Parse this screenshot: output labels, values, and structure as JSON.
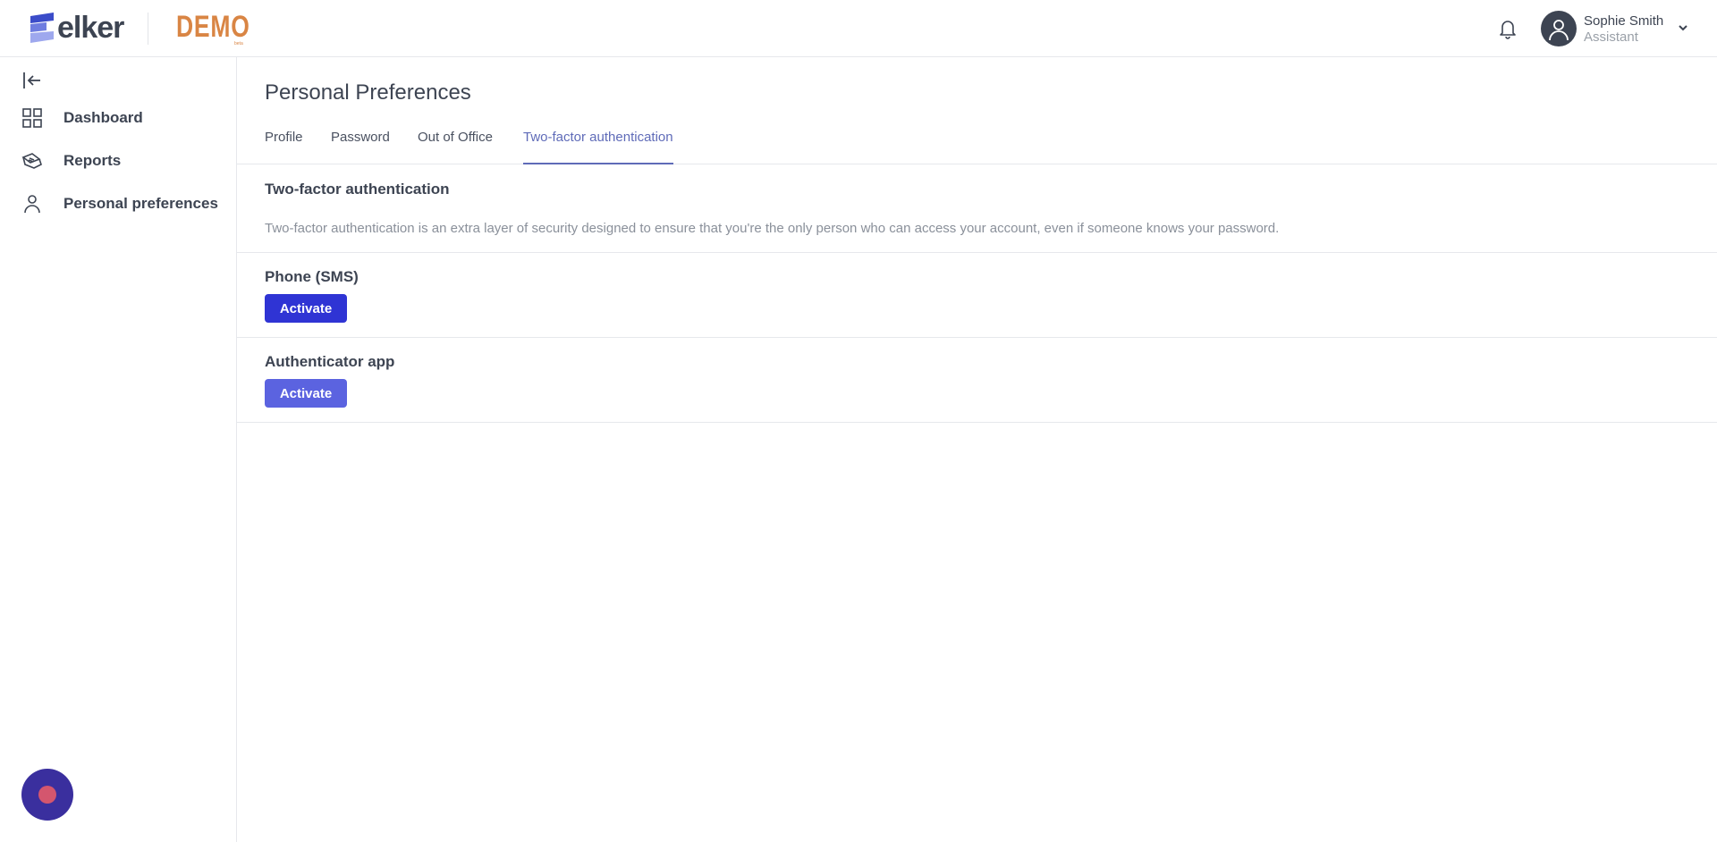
{
  "header": {
    "logo_text": "elker",
    "demo_badge": "DEMO",
    "demo_sub": "beta",
    "user": {
      "name": "Sophie Smith",
      "role": "Assistant"
    }
  },
  "sidebar": {
    "items": [
      {
        "label": "Dashboard",
        "icon": "grid-icon"
      },
      {
        "label": "Reports",
        "icon": "reports-icon"
      },
      {
        "label": "Personal preferences",
        "icon": "user-icon"
      }
    ]
  },
  "main": {
    "title": "Personal Preferences",
    "tabs": [
      {
        "label": "Profile",
        "active": false
      },
      {
        "label": "Password",
        "active": false
      },
      {
        "label": "Out of Office",
        "active": false
      },
      {
        "label": "Two-factor authentication",
        "active": true
      }
    ],
    "section": {
      "title": "Two-factor authentication",
      "description": "Two-factor authentication is an extra layer of security designed to ensure that you're the only person who can access your account, even if someone knows your password."
    },
    "methods": [
      {
        "title": "Phone (SMS)",
        "button_label": "Activate"
      },
      {
        "title": "Authenticator app",
        "button_label": "Activate"
      }
    ]
  },
  "colors": {
    "accent": "#5f6bb8",
    "primary_button": "#2f34d4",
    "secondary_button": "#5b63e0",
    "demo_badge": "#d98544",
    "chat_fab": "#3a2f9e"
  }
}
